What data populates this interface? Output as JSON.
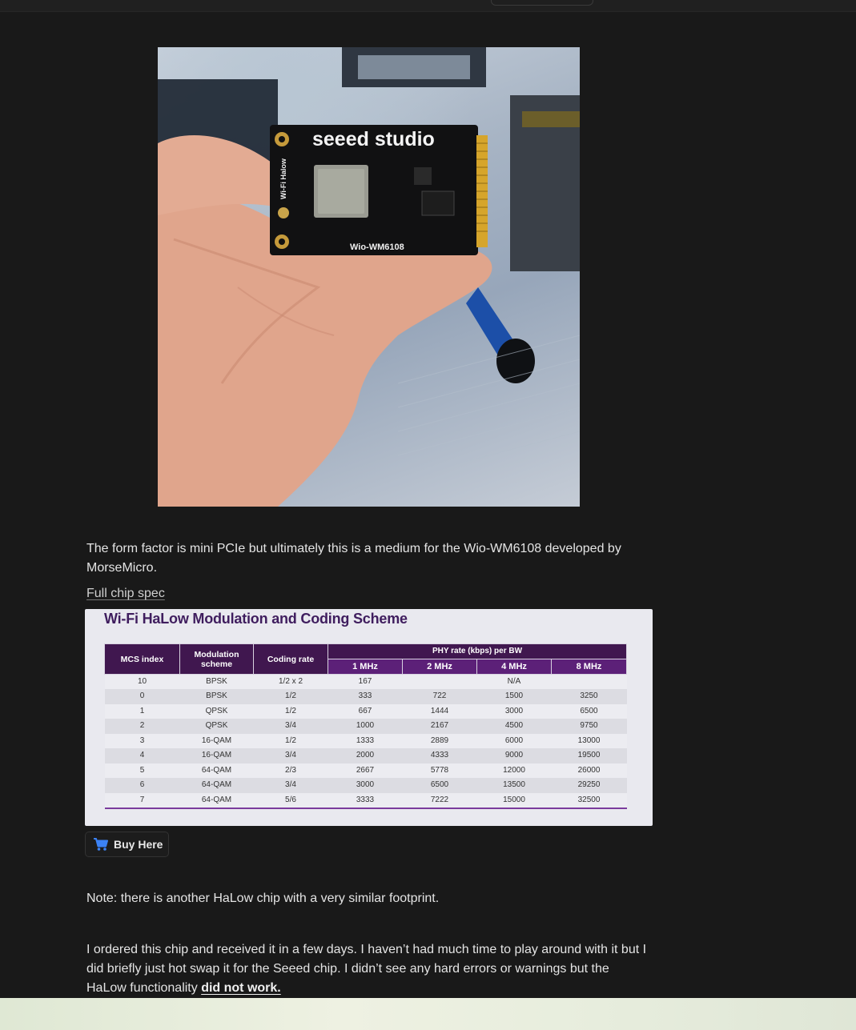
{
  "post": {
    "intro_paragraph": "The form factor is mini PCIe but ultimately this is a medium for the Wio-WM6108 developed by MorseMicro.",
    "spec_link": "Full chip spec",
    "buy_button_label": "Buy Here",
    "note_paragraph": "Note: there is another HaLow chip with a very similar footprint.",
    "order_paragraph_start": "I ordered this chip and received it in a few days. I haven’t had much time to play around with it but I did briefly just hot swap it for the Seeed chip. I didn’t see any hard errors or warnings but the HaLow functionality ",
    "order_paragraph_emphasis": "did not work."
  },
  "photo": {
    "board_brand": "seeed studio",
    "board_model": "Wio-WM6108",
    "board_side_label": "Wi-Fi Halow"
  },
  "spec_table": {
    "title": "Wi-Fi HaLow Modulation and Coding Scheme",
    "headers": {
      "mcs": "MCS index",
      "modulation": "Modulation scheme",
      "coding": "Coding rate",
      "phy_group": "PHY rate (kbps) per BW",
      "bw": [
        "1 MHz",
        "2 MHz",
        "4 MHz",
        "8 MHz"
      ]
    },
    "rows": [
      [
        "10",
        "BPSK",
        "1/2 x 2",
        "167",
        "",
        "N/A",
        ""
      ],
      [
        "0",
        "BPSK",
        "1/2",
        "333",
        "722",
        "1500",
        "3250"
      ],
      [
        "1",
        "QPSK",
        "1/2",
        "667",
        "1444",
        "3000",
        "6500"
      ],
      [
        "2",
        "QPSK",
        "3/4",
        "1000",
        "2167",
        "4500",
        "9750"
      ],
      [
        "3",
        "16-QAM",
        "1/2",
        "1333",
        "2889",
        "6000",
        "13000"
      ],
      [
        "4",
        "16-QAM",
        "3/4",
        "2000",
        "4333",
        "9000",
        "19500"
      ],
      [
        "5",
        "64-QAM",
        "2/3",
        "2667",
        "5778",
        "12000",
        "26000"
      ],
      [
        "6",
        "64-QAM",
        "3/4",
        "3000",
        "6500",
        "13500",
        "29250"
      ],
      [
        "7",
        "64-QAM",
        "5/6",
        "3333",
        "7222",
        "15000",
        "32500"
      ]
    ]
  },
  "colors": {
    "page_bg": "#191919",
    "table_header": "#40174f",
    "table_subheader": "#5c2078",
    "cart_icon": "#3b82f6"
  },
  "icons": {
    "buy": "cart-icon"
  }
}
